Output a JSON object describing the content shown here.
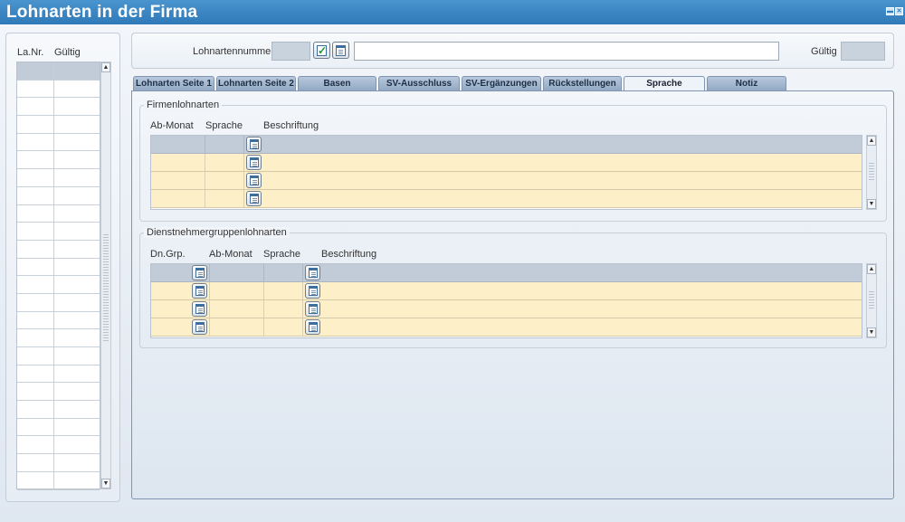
{
  "window": {
    "title": "Lohnarten in der Firma",
    "min_label": "▬",
    "close_label": "✕"
  },
  "left_list": {
    "headers": [
      "La.Nr.",
      "Gültig"
    ],
    "row_count": 24
  },
  "topbar": {
    "lohnartennummer_label": "Lohnartennummer",
    "lohnartennummer_value": "",
    "beschreibung_value": "",
    "gueltig_label": "Gültig",
    "gueltig_value": ""
  },
  "tabs": [
    {
      "label": "Lohnarten Seite 1",
      "active": false
    },
    {
      "label": "Lohnarten Seite 2",
      "active": false
    },
    {
      "label": "Basen",
      "active": false
    },
    {
      "label": "SV-Ausschluss",
      "active": false
    },
    {
      "label": "SV-Ergänzungen",
      "active": false
    },
    {
      "label": "Rückstellungen",
      "active": false
    },
    {
      "label": "Sprache",
      "active": true
    },
    {
      "label": "Notiz",
      "active": false
    }
  ],
  "firmenlohnarten": {
    "legend": "Firmenlohnarten",
    "columns": [
      "Ab-Monat",
      "Sprache",
      "Beschriftung"
    ],
    "rows": [
      {
        "ab_monat": "",
        "sprache": "",
        "beschriftung": ""
      },
      {
        "ab_monat": "",
        "sprache": "",
        "beschriftung": ""
      },
      {
        "ab_monat": "",
        "sprache": "",
        "beschriftung": ""
      },
      {
        "ab_monat": "",
        "sprache": "",
        "beschriftung": ""
      }
    ]
  },
  "dienstnehmergruppenlohnarten": {
    "legend": "Dienstnehmergruppenlohnarten",
    "columns": [
      "Dn.Grp.",
      "Ab-Monat",
      "Sprache",
      "Beschriftung"
    ],
    "rows": [
      {
        "dn_grp": "",
        "ab_monat": "",
        "sprache": "",
        "beschriftung": ""
      },
      {
        "dn_grp": "",
        "ab_monat": "",
        "sprache": "",
        "beschriftung": ""
      },
      {
        "dn_grp": "",
        "ab_monat": "",
        "sprache": "",
        "beschriftung": ""
      },
      {
        "dn_grp": "",
        "ab_monat": "",
        "sprache": "",
        "beschriftung": ""
      }
    ]
  },
  "colors": {
    "titlebar": "#3a86c4",
    "row_highlight": "#fdf0c8",
    "row_selected": "#c2ccd8"
  }
}
